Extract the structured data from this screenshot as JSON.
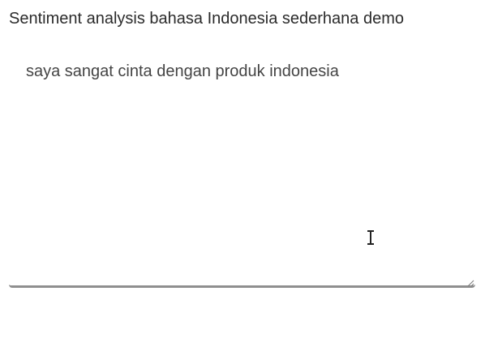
{
  "header": {
    "title": "Sentiment analysis bahasa Indonesia sederhana demo"
  },
  "input": {
    "value": "saya sangat cinta dengan produk indonesia",
    "underline_color": "#8f8f8f"
  },
  "icons": {
    "resize_handle": "resize-grip-icon",
    "cursor": "text-cursor-icon"
  }
}
